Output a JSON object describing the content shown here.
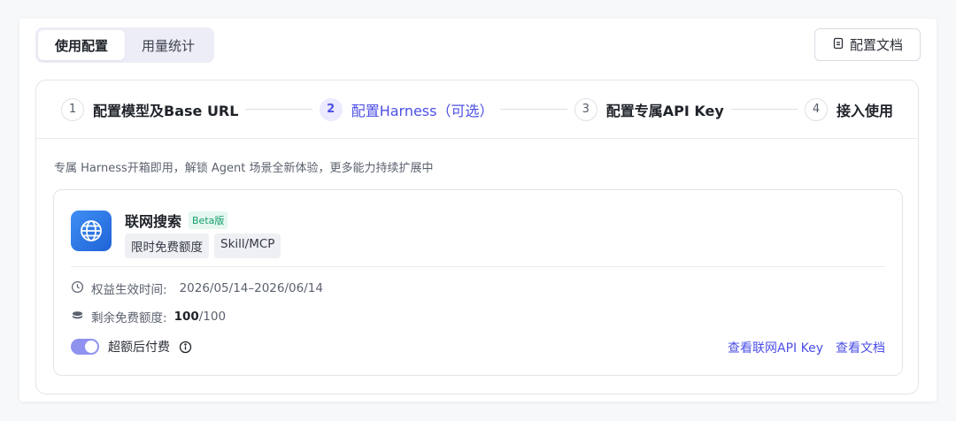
{
  "tabs": {
    "config": "使用配置",
    "usage": "用量统计"
  },
  "doc_button": "配置文档",
  "steps": [
    {
      "num": "1",
      "label": "配置模型及Base URL"
    },
    {
      "num": "2",
      "label": "配置Harness（可选）"
    },
    {
      "num": "3",
      "label": "配置专属API Key"
    },
    {
      "num": "4",
      "label": "接入使用"
    }
  ],
  "intro": "专属 Harness开箱即用，解锁 Agent 场景全新体验，更多能力持续扩展中",
  "plugin": {
    "name": "联网搜索",
    "badge": "Beta版",
    "tags": [
      "限时免费额度",
      "Skill/MCP"
    ],
    "period_label": "权益生效时间:",
    "period_value": "2026/05/14–2026/06/14",
    "quota_label": "剩余免费额度:",
    "quota_used": "100",
    "quota_total": "/100",
    "overage_label": "超额后付费",
    "overage_enabled": true,
    "link_api_key": "查看联网API Key",
    "link_docs": "查看文档"
  },
  "colors": {
    "accent": "#4c4fe6",
    "badge_green": "#13a06b",
    "toggle_on": "#8f92ef"
  }
}
